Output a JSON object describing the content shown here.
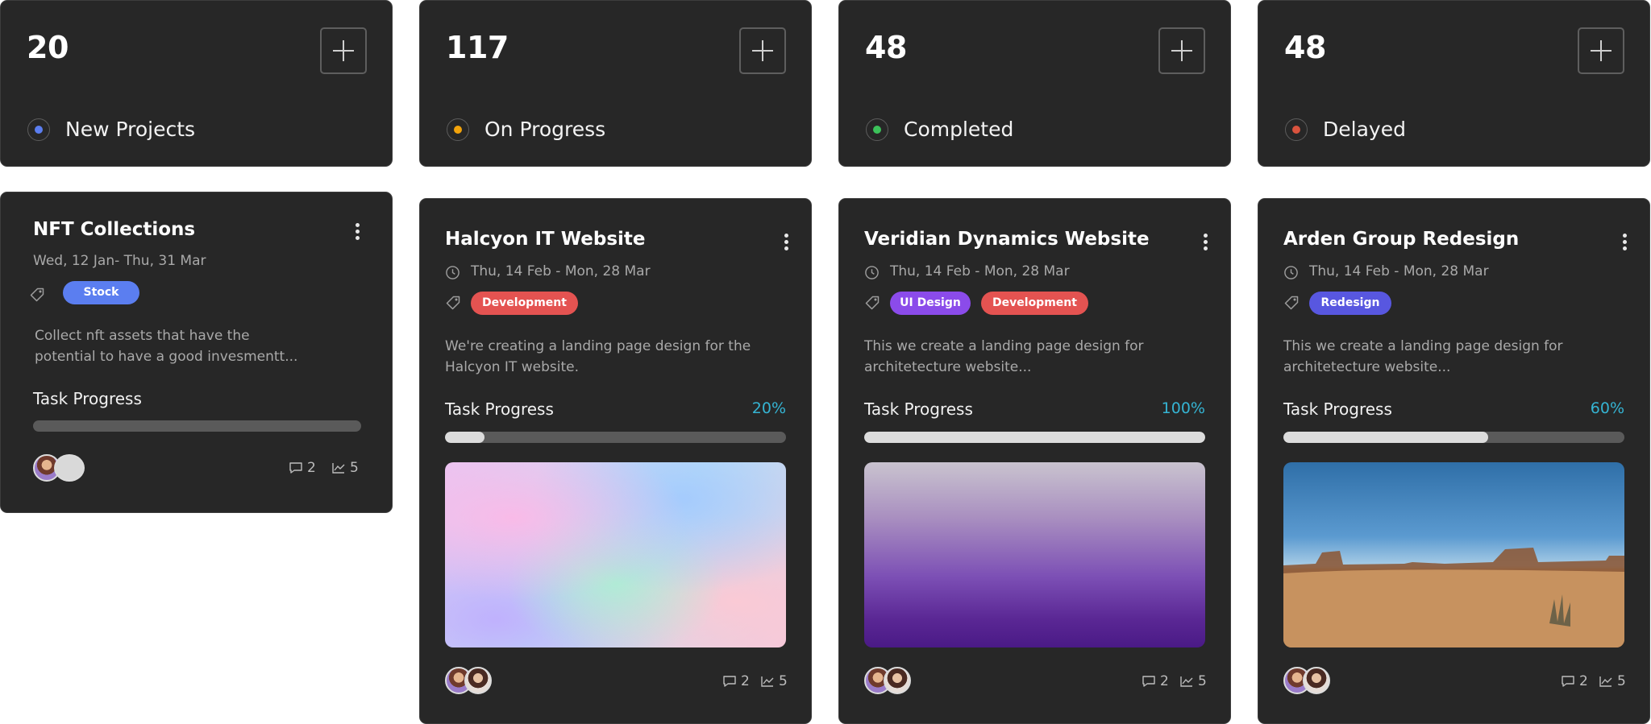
{
  "stats": [
    {
      "count": "20",
      "label": "New Projects",
      "dot_color": "#5b7ef0"
    },
    {
      "count": "117",
      "label": "On Progress",
      "dot_color": "#f2a30b"
    },
    {
      "count": "48",
      "label": "Completed",
      "dot_color": "#3cc25a"
    },
    {
      "count": "48",
      "label": "Delayed",
      "dot_color": "#d9533e"
    }
  ],
  "projects": [
    {
      "title": "NFT Collections",
      "date": "Wed, 12 Jan- Thu, 31 Mar",
      "tags": [
        {
          "label": "Stock",
          "color": "#5b7ef0"
        }
      ],
      "description": "Collect nft assets that have the potential to have a good invesmentt...",
      "progress_label": "Task Progress",
      "progress_value": 0,
      "comments": "2",
      "stats": "5"
    },
    {
      "title": "Halcyon IT Website",
      "date": "Thu, 14 Feb - Mon, 28 Mar",
      "tags": [
        {
          "label": "Development",
          "color": "#e45351"
        }
      ],
      "description": "We're creating a landing page design for the Halcyon IT website.",
      "progress_label": "Task Progress",
      "progress_percent": "20%",
      "progress_value": 0.2,
      "image": "pastel-holographic-gradient",
      "comments": "2",
      "stats": "5"
    },
    {
      "title": "Veridian Dynamics Website",
      "date": "Thu, 14 Feb - Mon, 28 Mar",
      "tags": [
        {
          "label": "UI Design",
          "color": "#8b4bea"
        },
        {
          "label": "Development",
          "color": "#e45351"
        }
      ],
      "description": "This we create a landing page design for architetecture website...",
      "progress_label": "Task Progress",
      "progress_percent": "100%",
      "progress_value": 1.0,
      "image": "purple-gradient",
      "comments": "2",
      "stats": "5"
    },
    {
      "title": "Arden Group Redesign",
      "date": "Thu, 14 Feb - Mon, 28 Mar",
      "tags": [
        {
          "label": "Redesign",
          "color": "#5857e0"
        }
      ],
      "description": "This we create a landing page design for architetecture website...",
      "progress_label": "Task Progress",
      "progress_percent": "60%",
      "progress_value": 0.6,
      "image": "desert-landscape-photo",
      "comments": "2",
      "stats": "5"
    }
  ],
  "icons": {
    "add": "plus-icon",
    "menu": "kebab-menu-icon",
    "date": "clock-icon",
    "tag": "tag-icon",
    "comments": "comment-icon",
    "stats": "trend-chart-icon"
  }
}
